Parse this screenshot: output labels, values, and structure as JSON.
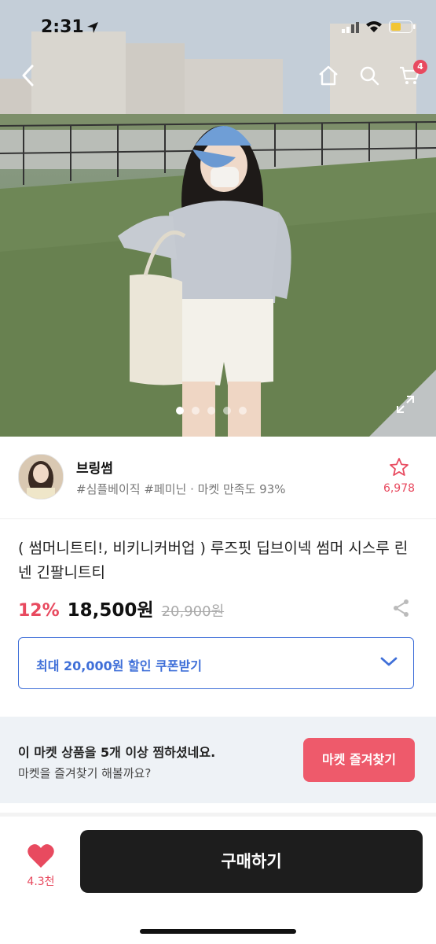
{
  "status_bar": {
    "time": "2:31"
  },
  "header": {
    "cart_count": "4"
  },
  "gallery": {
    "dots_total": 5,
    "active_index": 0
  },
  "shop": {
    "name": "브링썸",
    "tags": "#심플베이직 #페미닌 · 마켓 만족도 93%",
    "favorite_count": "6,978"
  },
  "product": {
    "title": "( 썸머니트티!, 비키니커버업 ) 루즈핏 딥브이넥 썸머 시스루 린넨 긴팔니트티",
    "discount": "12%",
    "price": "18,500원",
    "original_price": "20,900원"
  },
  "coupon": {
    "label": "최대 20,000원 할인 쿠폰받기"
  },
  "banner": {
    "line1": "이 마켓 상품을 5개 이상 찜하셨네요.",
    "line2": "마켓을 즐겨찾기 해볼까요?",
    "button": "마켓 즐겨찾기"
  },
  "bottom_bar": {
    "like_count": "4.3천",
    "buy_label": "구매하기"
  },
  "colors": {
    "accent": "#e84a5f",
    "coupon_blue": "#3f6fd8",
    "buy_button": "#1d1d1d",
    "banner_bg": "#eef2f6"
  }
}
